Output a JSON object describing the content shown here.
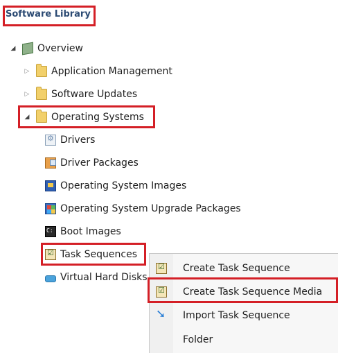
{
  "header": {
    "title": "Software Library"
  },
  "tree": {
    "overview": "Overview",
    "items": [
      {
        "label": "Application Management"
      },
      {
        "label": "Software Updates"
      },
      {
        "label": "Operating Systems"
      }
    ],
    "os_children": [
      {
        "label": "Drivers",
        "icon": "driver-icon"
      },
      {
        "label": "Driver Packages",
        "icon": "driver-package-icon"
      },
      {
        "label": "Operating System Images",
        "icon": "os-image-icon"
      },
      {
        "label": "Operating System Upgrade Packages",
        "icon": "os-upgrade-package-icon"
      },
      {
        "label": "Boot Images",
        "icon": "boot-image-icon"
      },
      {
        "label": "Task Sequences",
        "icon": "task-sequence-icon"
      },
      {
        "label": "Virtual Hard Disks",
        "icon": "virtual-hard-disk-icon"
      }
    ]
  },
  "context_menu": {
    "items": [
      {
        "label": "Create Task Sequence",
        "icon": "task-sequence-icon"
      },
      {
        "label": "Create Task Sequence Media",
        "icon": "task-sequence-media-icon"
      },
      {
        "label": "Import Task Sequence",
        "icon": "import-arrow-icon"
      },
      {
        "label": "Folder",
        "icon": ""
      }
    ]
  },
  "colors": {
    "highlight": "#d41f26",
    "header_text": "#2b4a73"
  }
}
